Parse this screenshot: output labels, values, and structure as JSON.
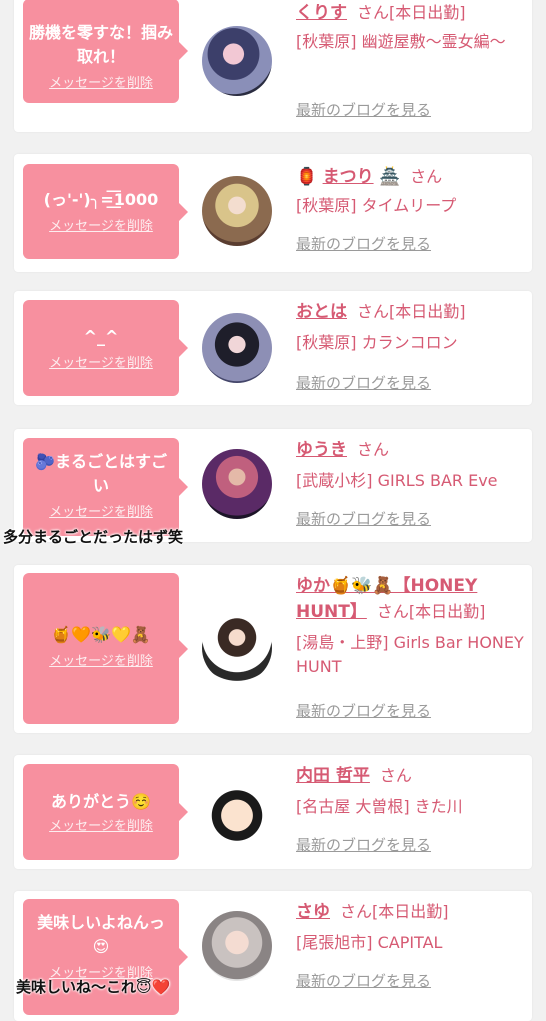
{
  "delete_label": "メッセージを削除",
  "blog_label": "最新のブログを見る",
  "san_label": "さん",
  "entries": [
    {
      "message": "勝機を零すな！掴み取れ！",
      "name": "くりす",
      "status": "[本日出勤]",
      "shop": "[秋葉原] 幽遊屋敷～霊女編～"
    },
    {
      "message": "(っ'-')╮=͟͟͞͞1000",
      "name_prefix": "🏮",
      "name": "まつり",
      "name_suffix": "🏯",
      "status": "",
      "shop": "[秋葉原] タイムリープ"
    },
    {
      "message": "^_^",
      "name": "おとは",
      "status": "[本日出勤]",
      "shop": "[秋葉原] カランコロン"
    },
    {
      "message": "🫐まるごとはすごい",
      "name": "ゆうき",
      "status": "",
      "shop": "[武蔵小杉] GIRLS BAR Eve"
    },
    {
      "message": "🍯🧡🐝💛🧸",
      "name": "ゆか🍯🐝🧸【HONEY HUNT】",
      "status": "[本日出勤]",
      "shop": "[湯島・上野] Girls Bar HONEY HUNT"
    },
    {
      "message": "ありがとう☺️",
      "name": "内田 哲平",
      "status": "",
      "shop": "[名古屋 大曽根] きた川"
    },
    {
      "message": "美味しいよねんっ😍",
      "name": "さゆ",
      "status": "[本日出勤]",
      "shop": "[尾張旭市] CAPITAL"
    }
  ],
  "overlays": {
    "text1": "多分まるごとだったはず笑",
    "text2": "美味しいね〜これ😇❤️"
  },
  "colors": {
    "accent": "#d65a73",
    "bubble": "#f7909f",
    "background": "#f1f1f1"
  }
}
